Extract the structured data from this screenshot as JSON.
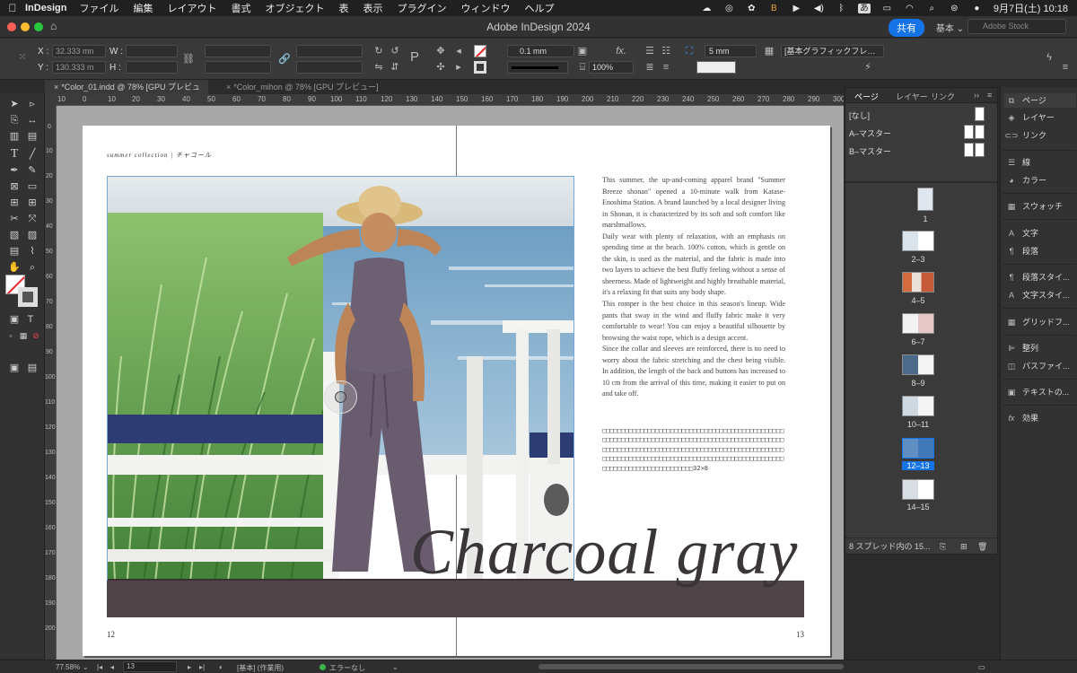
{
  "menubar": {
    "app_name": "InDesign",
    "items": [
      "ファイル",
      "編集",
      "レイアウト",
      "書式",
      "オブジェクト",
      "表",
      "表示",
      "プラグイン",
      "ウィンドウ",
      "ヘルプ"
    ],
    "ime": "あ",
    "datetime": "9月7日(土)  10:18"
  },
  "window": {
    "title": "Adobe InDesign 2024",
    "share_label": "共有",
    "workspace": "基本 ⌄",
    "stock_placeholder": "Adobe Stock"
  },
  "control": {
    "x_label": "X :",
    "x_value": "32.333 mn",
    "y_label": "Y :",
    "y_value": "130.333 m",
    "w_label": "W :",
    "h_label": "H :",
    "stroke_weight": "0.1 mm",
    "opacity": "100%",
    "gap": "5 mm",
    "style": "[基本グラフィックフレ…"
  },
  "tabs": [
    {
      "label": "*Color_01.indd @ 78% [GPU プレビュー]",
      "active": true
    },
    {
      "label": "*Color_mihon @ 78% [GPU プレビュー]",
      "active": false
    }
  ],
  "ruler": {
    "h_ticks": [
      "10",
      "0",
      "10",
      "20",
      "30",
      "40",
      "50",
      "60",
      "70",
      "80",
      "90",
      "100",
      "110",
      "120",
      "130",
      "140",
      "150",
      "160",
      "170",
      "180",
      "190",
      "200",
      "210",
      "220",
      "230",
      "240",
      "250",
      "260",
      "270",
      "280",
      "290",
      "300"
    ],
    "v_ticks": [
      "0",
      "10",
      "20",
      "30",
      "40",
      "50",
      "60",
      "70",
      "80",
      "90",
      "100",
      "110",
      "120",
      "130",
      "140",
      "150",
      "160",
      "170",
      "180",
      "190",
      "200"
    ]
  },
  "spread": {
    "running_head": "summer collection | チャコール",
    "body": "This summer, the up-and-coming apparel brand \"Summer Breeze shonan\" opened a 10-minute walk from Katase-Enoshima Station. A brand launched by a local designer living in Shonan, it is characterized by its soft and soft comfort like marshmallows.\nDaily wear with plenty of relaxation, with an emphasis on spending time at the beach. 100% cotton, which is gentle on the skin, is used as the material, and the fabric is made into two layers to achieve the best fluffy feeling without a sense of sheerness. Made of lightweight and highly breathable material, it's a relaxing fit that suits any body shape.\nThis romper is the best choice in this season's lineup. Wide pants that sway in the wind and fluffy fabric make it very comfortable to wear! You can enjoy a beautiful silhouette by browsing the waist rope, which is a design accent.\nSince the collar and sleeves are reinforced, there is no need to worry about the fabric stretching and the chest being visible. In addition, the length of the back and buttons has increased to 10 cm from the arrival of this time, making it easier to put on and take off.",
    "placeholder": "□□□□□□□□□□□□□□□□□□□□□□□□□□□□□□□□□□□□□□□□□□□□□□□□□□□□□□□□□□□□□□□□□□□□□□□□□□□□□□□□□□□□□□□□□□□□□□□□□□□□□□□□□□□□□□□□□□□□□□□□□□□□□□□□□□□□□□□□□□□□□□□□□□□□□□□□□□□□□□□□□□□□□□□□□□□□□□□□□□□□□□□□□□□□□□□□□□□□□□□□□□□□□□□□□□□□□□□□32×8",
    "headline": "Charcoal gray",
    "folio_left": "12",
    "folio_right": "13",
    "band_color": "#4f4548"
  },
  "pages_panel": {
    "tabs": [
      "ページ",
      "レイヤー",
      "リンク"
    ],
    "masters": [
      "[なし]",
      "A–マスター",
      "B–マスター"
    ],
    "pages": [
      {
        "label": "1",
        "selected": false
      },
      {
        "label": "2–3",
        "selected": false
      },
      {
        "label": "4–5",
        "selected": false
      },
      {
        "label": "6–7",
        "selected": false
      },
      {
        "label": "8–9",
        "selected": false
      },
      {
        "label": "10–11",
        "selected": false
      },
      {
        "label": "12–13",
        "selected": true
      },
      {
        "label": "14–15",
        "selected": false
      }
    ],
    "footer": "8 スプレッド内の 15..."
  },
  "dock": [
    "ページ",
    "レイヤー",
    "リンク",
    "線",
    "カラー",
    "スウォッチ",
    "文字",
    "段落",
    "段落スタイ...",
    "文字スタイ...",
    "グリッドフ...",
    "整列",
    "パスファイ...",
    "テキストの...",
    "効果"
  ],
  "status": {
    "zoom": "77.58%",
    "page": "13",
    "profile": "[基本] (作業用)",
    "preflight": "エラーなし"
  },
  "colors": {
    "accent": "#1473e6",
    "preflight_ok": "#3ab54a"
  }
}
